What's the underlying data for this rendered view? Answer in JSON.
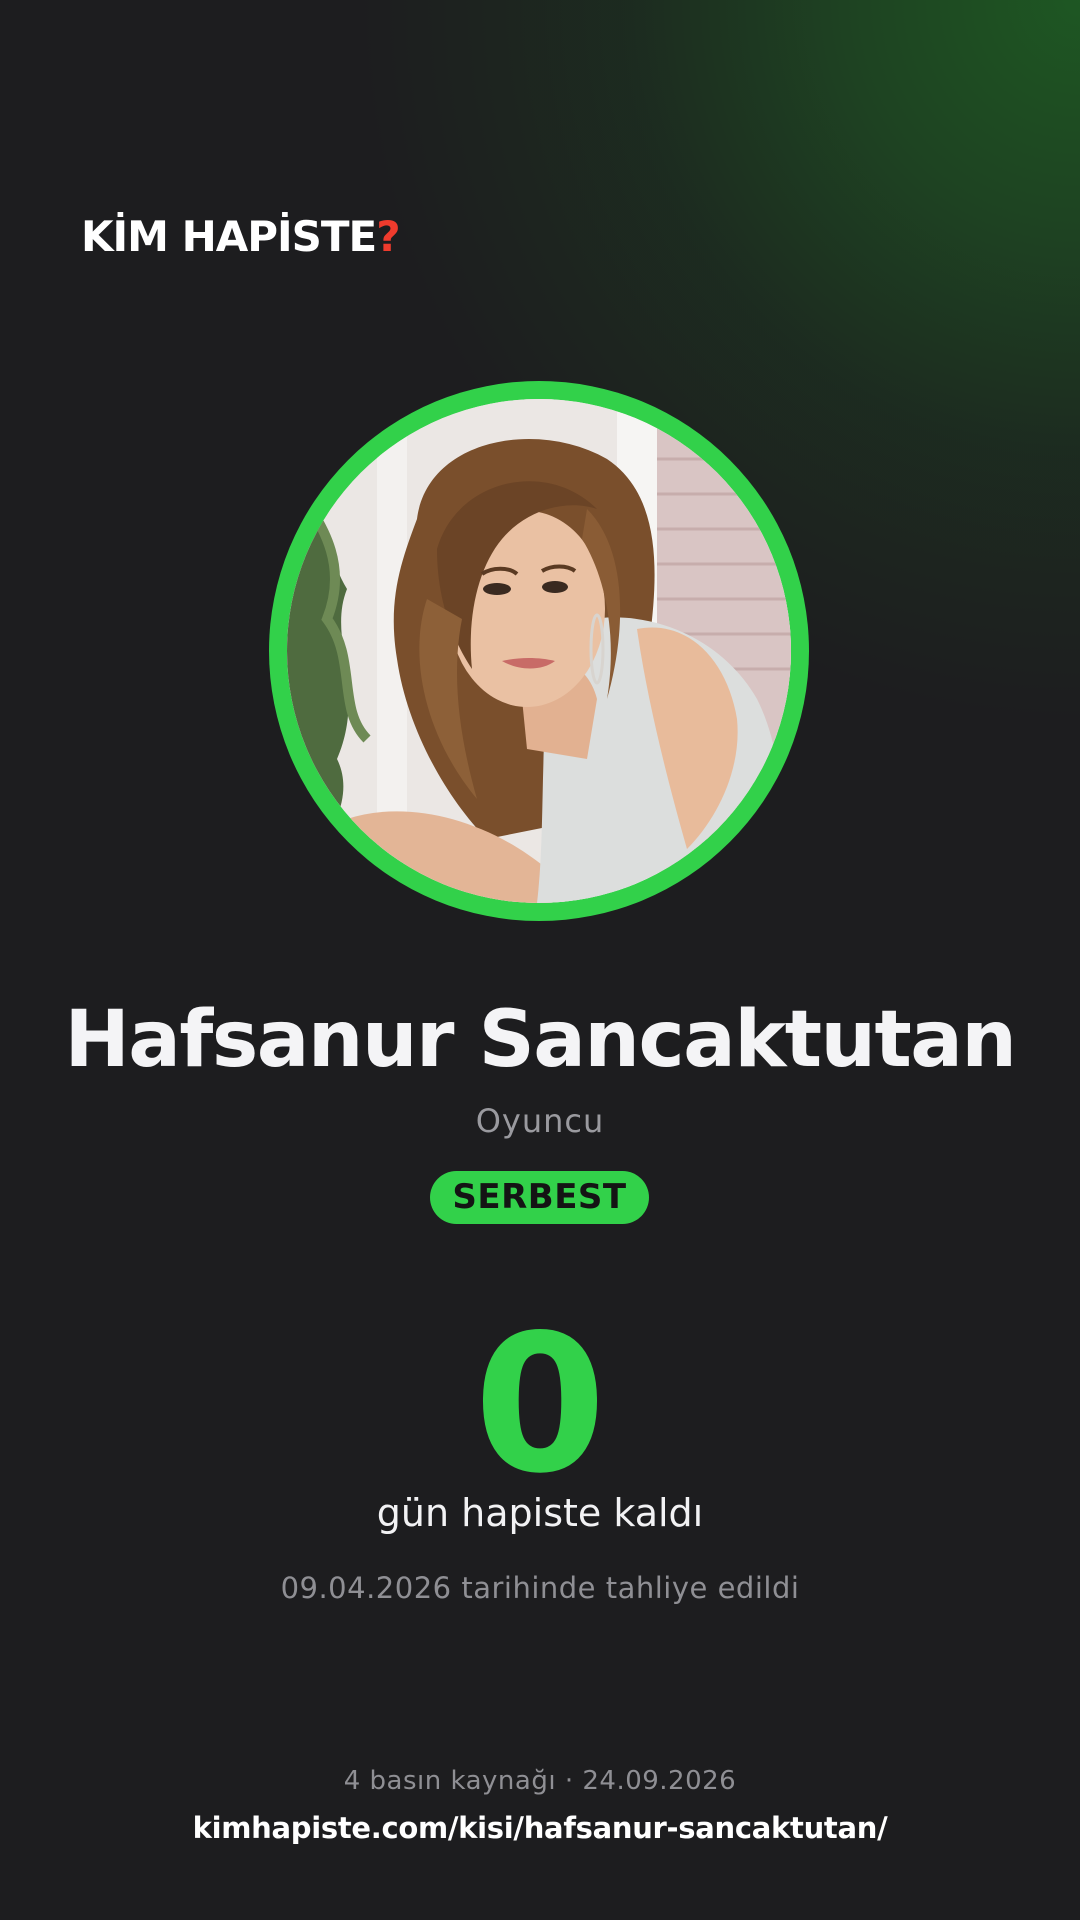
{
  "brand": {
    "logo_text": "KİM HAPİSTE",
    "logo_mark": "?",
    "mark_color": "#ef3b2d"
  },
  "profile": {
    "name": "Hafsanur Sancaktutan",
    "role": "Oyuncu",
    "status": "SERBEST",
    "accent_color": "#32d14a"
  },
  "stats": {
    "days_value": "0",
    "days_label": "gün hapiste kaldı",
    "release_text": "09.04.2026 tarihinde tahliye edildi"
  },
  "footer": {
    "sources": "4 basın kaynağı · 24.09.2026",
    "url": "kimhapiste.com/kisi/hafsanur-sancaktutan/"
  }
}
